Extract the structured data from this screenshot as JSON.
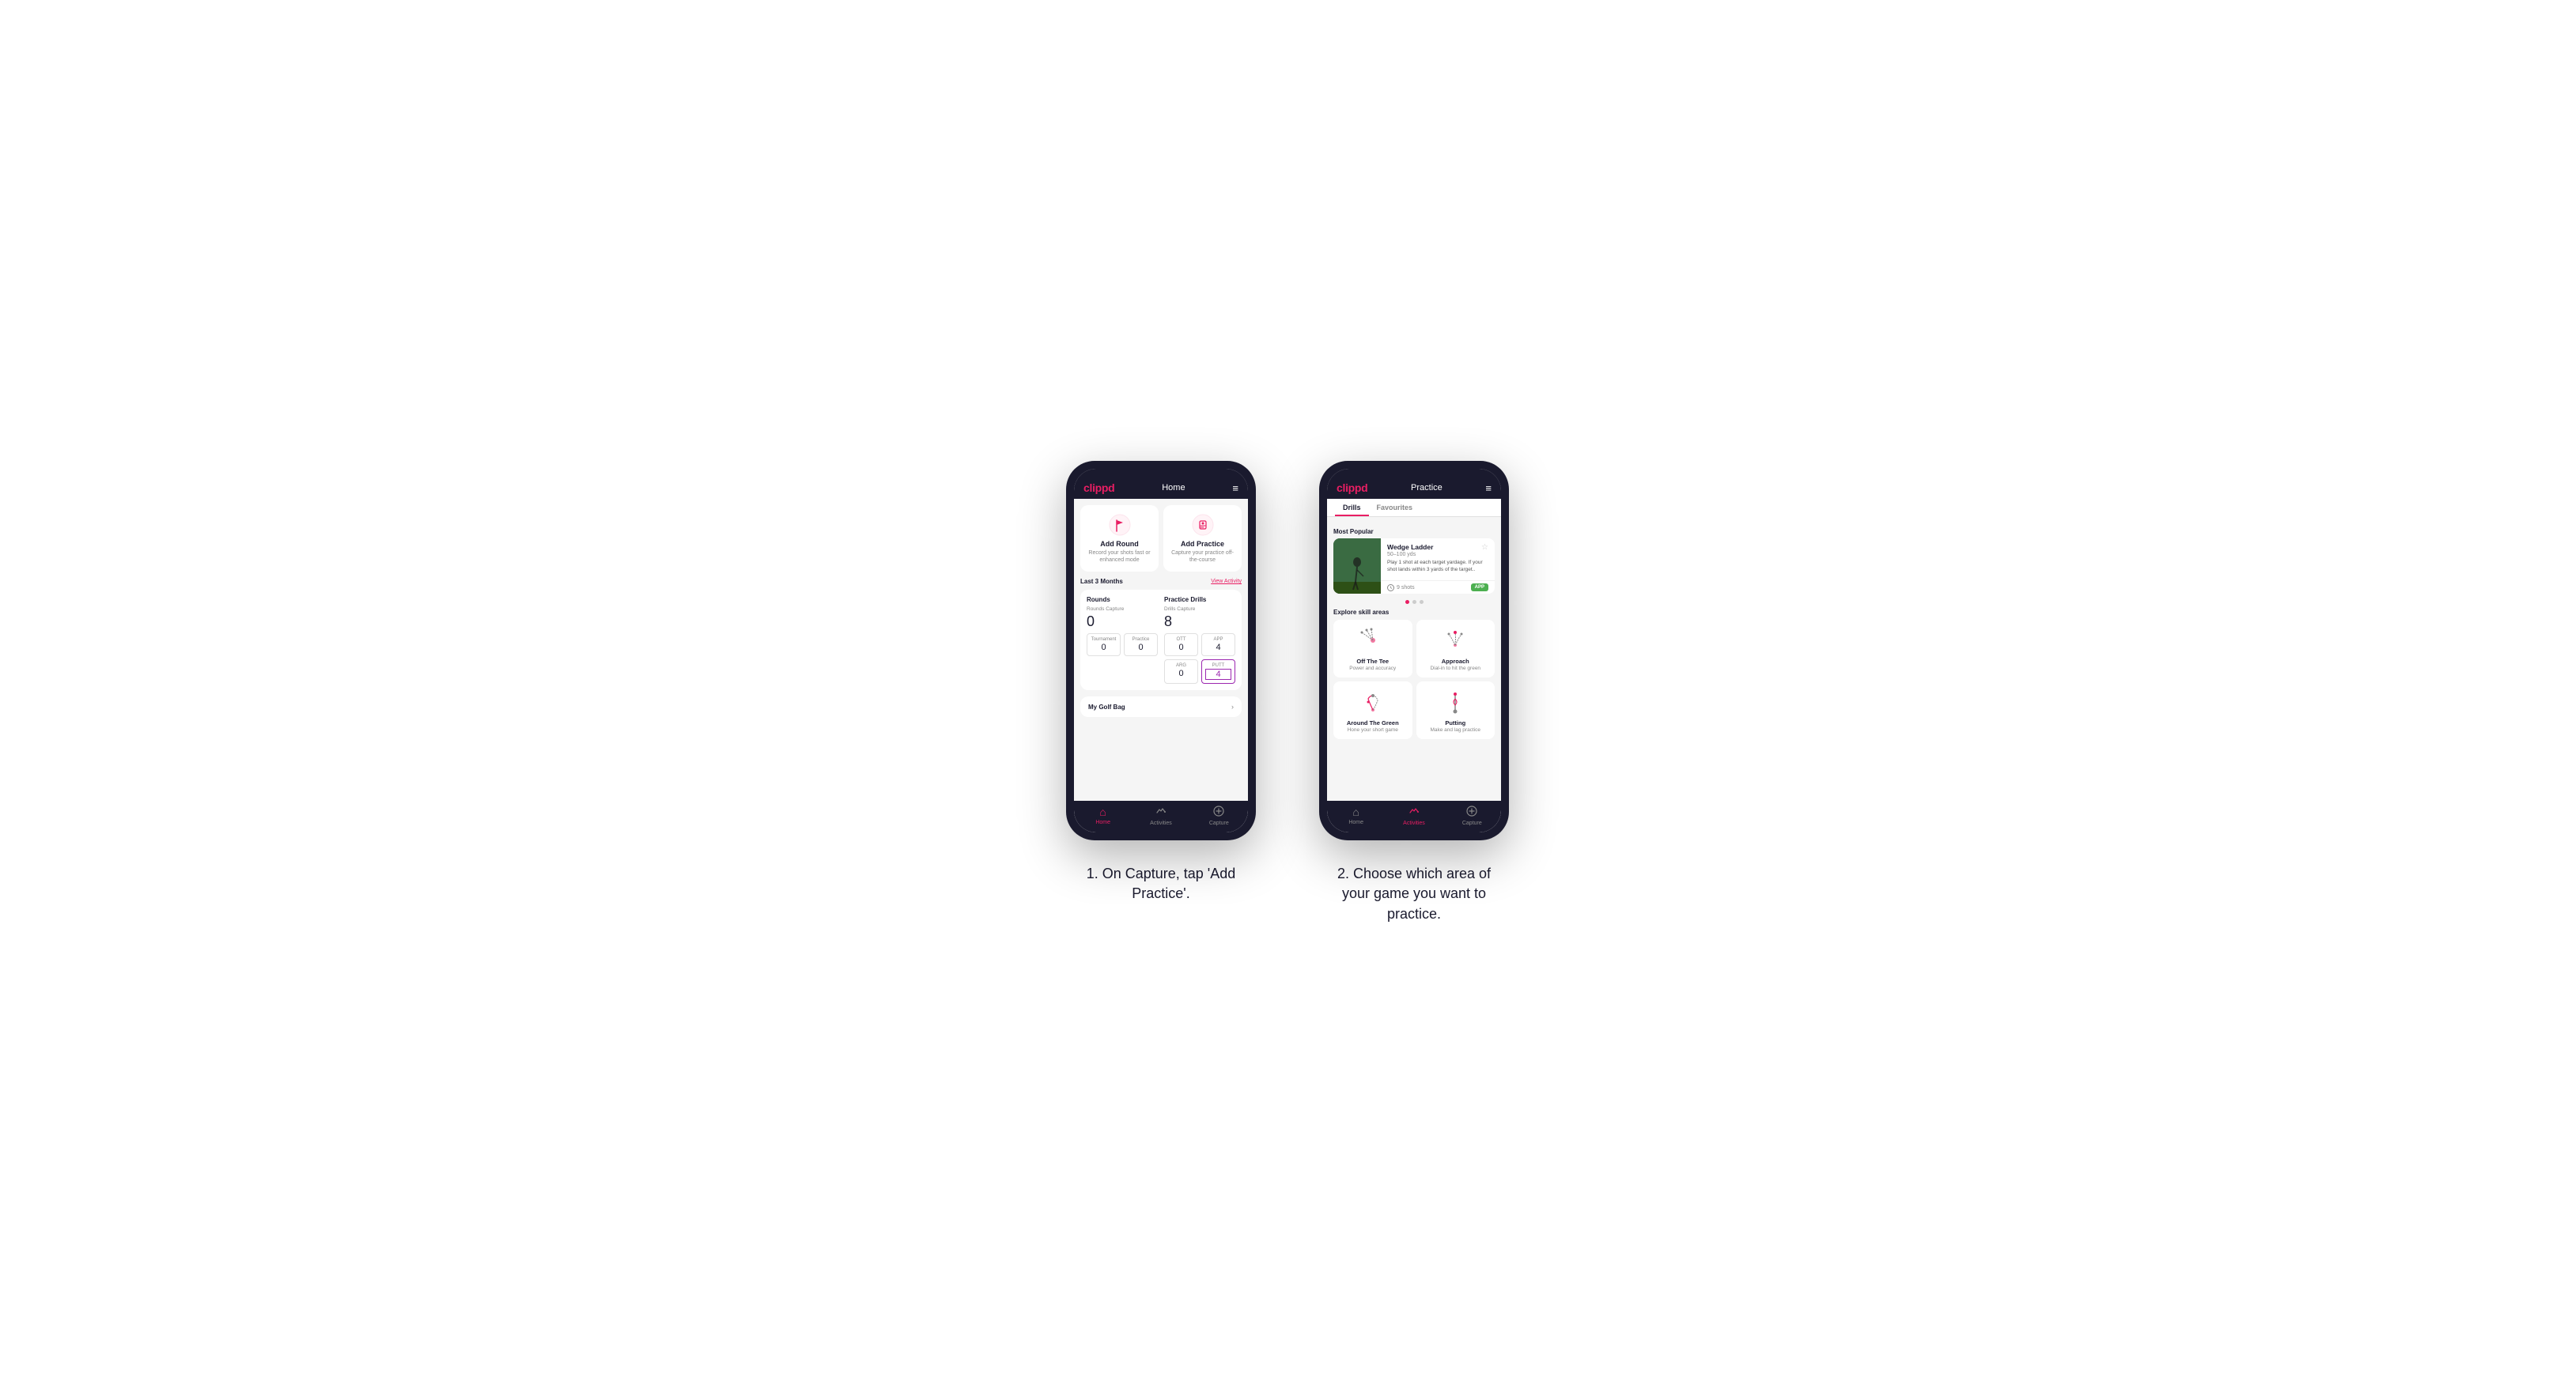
{
  "phone1": {
    "header": {
      "logo": "clippd",
      "title": "Home",
      "menu_icon": "≡"
    },
    "actions": [
      {
        "id": "add-round",
        "title": "Add Round",
        "desc": "Record your shots fast or enhanced mode"
      },
      {
        "id": "add-practice",
        "title": "Add Practice",
        "desc": "Capture your practice off-the-course"
      }
    ],
    "stats": {
      "period": "Last 3 Months",
      "view_link": "View Activity",
      "rounds": {
        "label": "Rounds",
        "capture_label": "Rounds Capture",
        "value": "0",
        "sub": [
          {
            "label": "Tournament",
            "value": "0"
          },
          {
            "label": "Practice",
            "value": "0"
          }
        ]
      },
      "drills": {
        "label": "Practice Drills",
        "capture_label": "Drills Capture",
        "value": "8",
        "sub": [
          {
            "label": "OTT",
            "value": "0"
          },
          {
            "label": "APP",
            "value": "4",
            "highlight": false
          },
          {
            "label": "ARG",
            "value": "0"
          },
          {
            "label": "PUTT",
            "value": "4",
            "highlight": true
          }
        ]
      }
    },
    "golf_bag": {
      "label": "My Golf Bag",
      "chevron": "›"
    },
    "bottom_nav": [
      {
        "label": "Home",
        "active": true,
        "icon": "⌂"
      },
      {
        "label": "Activities",
        "active": false,
        "icon": "♪"
      },
      {
        "label": "Capture",
        "active": false,
        "icon": "⊕"
      }
    ]
  },
  "phone2": {
    "header": {
      "logo": "clippd",
      "title": "Practice",
      "menu_icon": "≡"
    },
    "tabs": [
      {
        "label": "Drills",
        "active": true
      },
      {
        "label": "Favourites",
        "active": false
      }
    ],
    "most_popular": {
      "label": "Most Popular",
      "card": {
        "title": "Wedge Ladder",
        "subtitle": "50–100 yds",
        "desc": "Play 1 shot at each target yardage. If your shot lands within 3 yards of the target..",
        "shots": "9 shots",
        "badge": "APP"
      },
      "dots": [
        true,
        false,
        false
      ]
    },
    "explore": {
      "label": "Explore skill areas",
      "skills": [
        {
          "id": "off-the-tee",
          "title": "Off The Tee",
          "desc": "Power and accuracy",
          "diagram": "tee"
        },
        {
          "id": "approach",
          "title": "Approach",
          "desc": "Dial-in to hit the green",
          "diagram": "approach"
        },
        {
          "id": "around-the-green",
          "title": "Around The Green",
          "desc": "Hone your short game",
          "diagram": "atg"
        },
        {
          "id": "putting",
          "title": "Putting",
          "desc": "Make and lag practice",
          "diagram": "putt"
        }
      ]
    },
    "bottom_nav": [
      {
        "label": "Home",
        "active": false,
        "icon": "⌂"
      },
      {
        "label": "Activities",
        "active": true,
        "icon": "♪"
      },
      {
        "label": "Capture",
        "active": false,
        "icon": "⊕"
      }
    ]
  },
  "captions": {
    "caption1": "1. On Capture, tap 'Add Practice'.",
    "caption2": "2. Choose which area of your game you want to practice."
  },
  "colors": {
    "brand_pink": "#e91e63",
    "dark_navy": "#1a1a2e",
    "green_badge": "#4caf50",
    "purple": "#9c27b0"
  }
}
